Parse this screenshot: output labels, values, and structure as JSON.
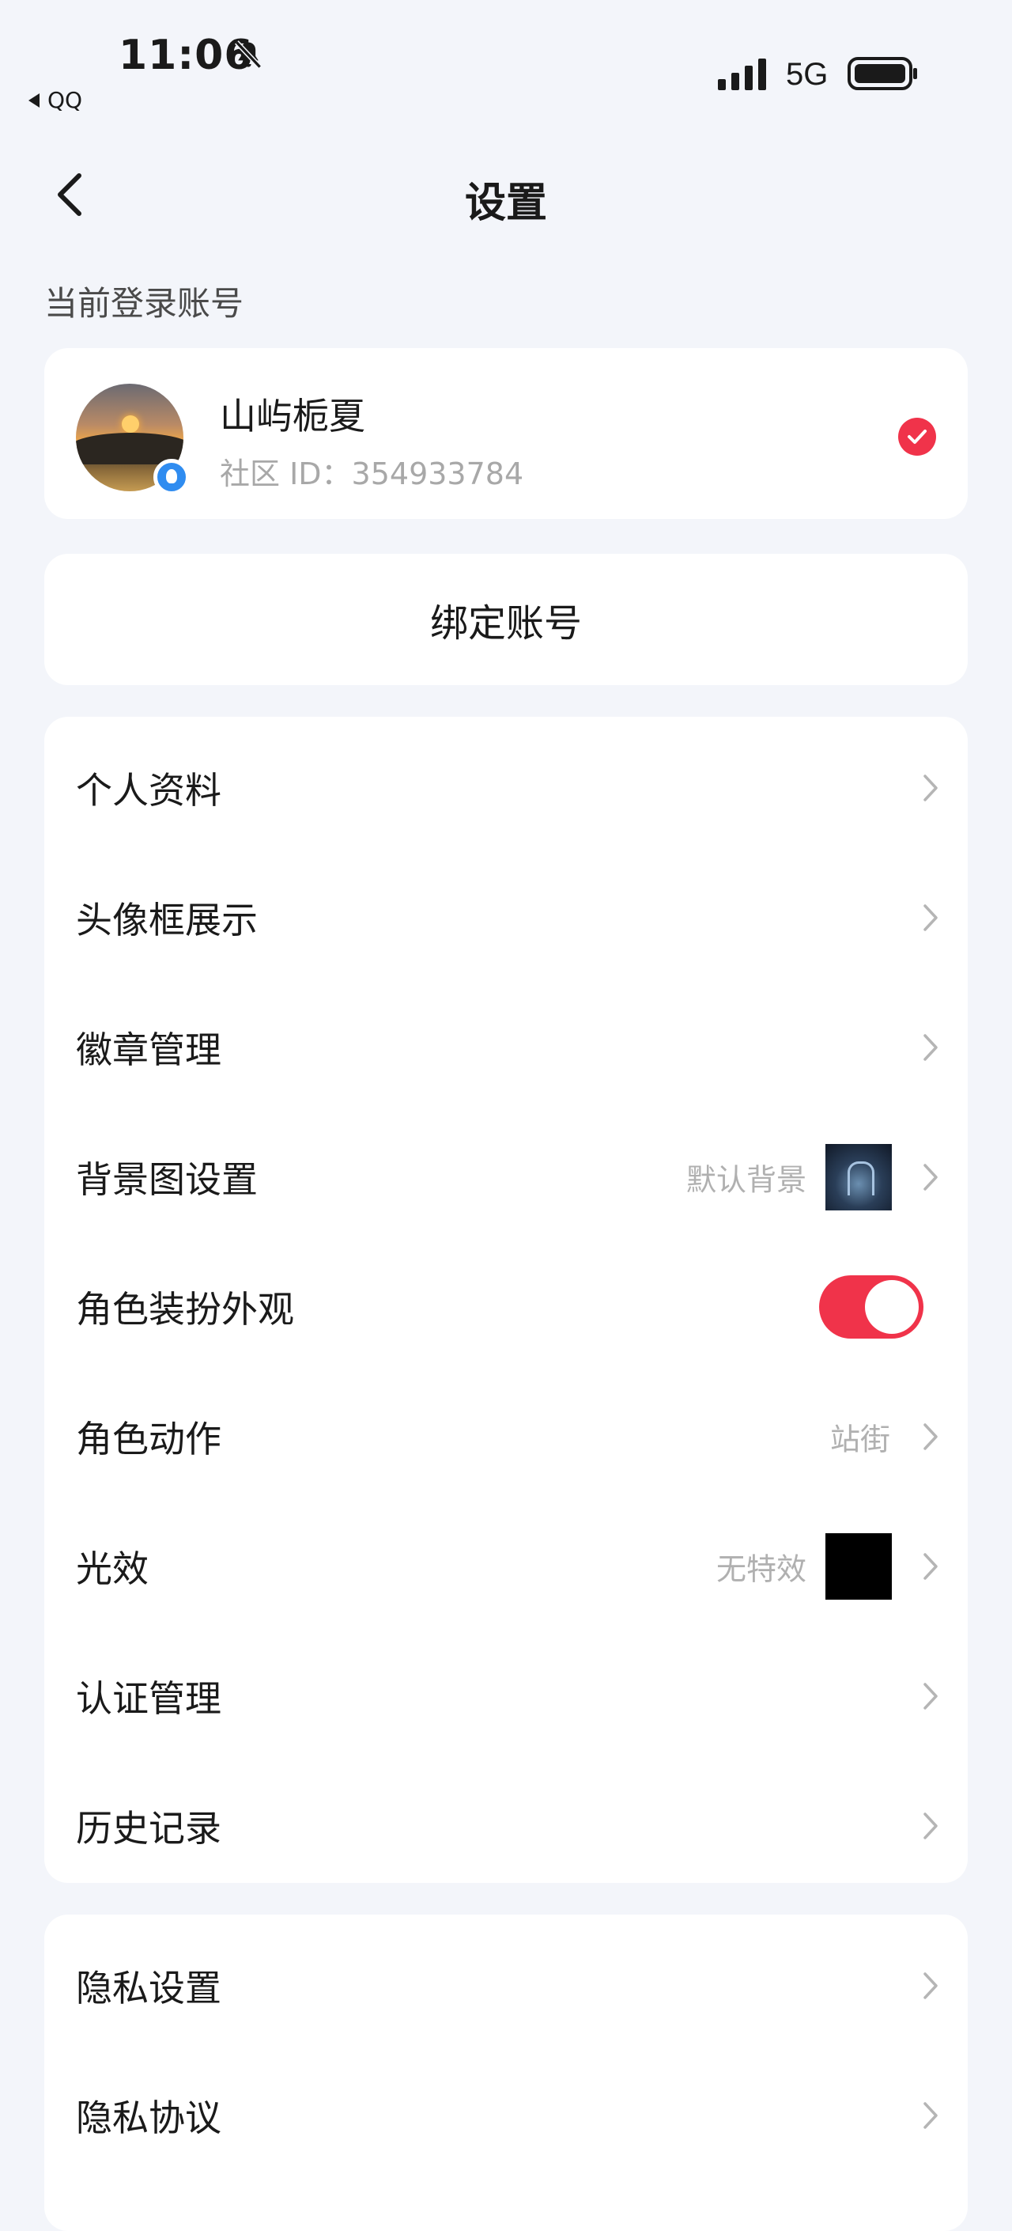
{
  "status_bar": {
    "time": "11:06",
    "back_app": "QQ",
    "network": "5G",
    "icons": [
      "bell-muted-icon",
      "signal-icon",
      "battery-icon"
    ]
  },
  "header": {
    "title": "设置",
    "back_icon": "chevron-left-icon"
  },
  "account": {
    "section_label": "当前登录账号",
    "name": "山屿栀夏",
    "id_text": "社区 ID：354933784",
    "selected": true
  },
  "bind_account_label": "绑定账号",
  "menu": [
    {
      "label": "个人资料"
    },
    {
      "label": "头像框展示"
    },
    {
      "label": "徽章管理"
    },
    {
      "label": "背景图设置",
      "value": "默认背景"
    },
    {
      "label": "角色装扮外观",
      "toggle": true
    },
    {
      "label": "角色动作",
      "value": "站街"
    },
    {
      "label": "光效",
      "value": "无特效"
    },
    {
      "label": "认证管理"
    },
    {
      "label": "历史记录"
    }
  ],
  "menu2": [
    {
      "label": "隐私设置"
    },
    {
      "label": "隐私协议"
    }
  ],
  "colors": {
    "accent": "#f0334a",
    "background": "#f3f5fa",
    "card": "#ffffff",
    "muted_text": "#b0b0b0"
  }
}
